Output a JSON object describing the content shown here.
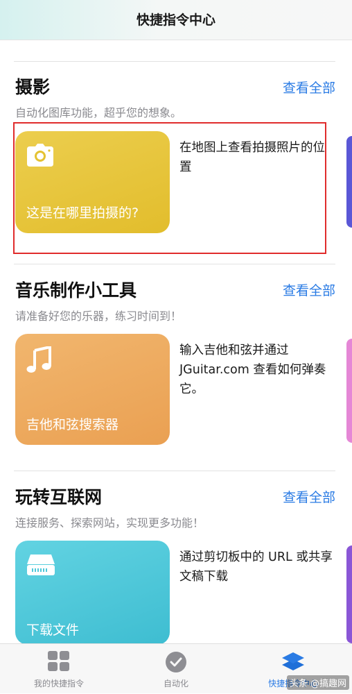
{
  "header": {
    "title": "快捷指令中心"
  },
  "sections": [
    {
      "title": "摄影",
      "see_all": "查看全部",
      "subtitle": "自动化图库功能，超乎您的想象。",
      "card": {
        "label": "这是在哪里拍摄的?",
        "icon": "camera-icon",
        "color": "#e6c437"
      },
      "description": "在地图上查看拍摄照片的位置"
    },
    {
      "title": "音乐制作小工具",
      "see_all": "查看全部",
      "subtitle": "请准备好您的乐器，练习时间到！",
      "card": {
        "label": "吉他和弦搜索器",
        "icon": "music-note-icon",
        "color": "#eea95c"
      },
      "description": "输入吉他和弦并通过JGuitar.com 查看如何弹奏它。"
    },
    {
      "title": "玩转互联网",
      "see_all": "查看全部",
      "subtitle": "连接服务、探索网站，实现更多功能！",
      "card": {
        "label": "下载文件",
        "icon": "download-drive-icon",
        "color": "#4fc8da"
      },
      "description": "通过剪切板中的 URL 或共享文稿下载"
    }
  ],
  "tabbar": {
    "tabs": [
      {
        "label": "我的快捷指令",
        "icon": "grid-icon",
        "active": false
      },
      {
        "label": "自动化",
        "icon": "clock-check-icon",
        "active": false
      },
      {
        "label": "快捷指令中心",
        "icon": "layers-icon",
        "active": true
      }
    ]
  },
  "watermark": "头条 @搞趣网",
  "colors": {
    "accent": "#2a7be4",
    "highlight": "#e02b2b"
  }
}
